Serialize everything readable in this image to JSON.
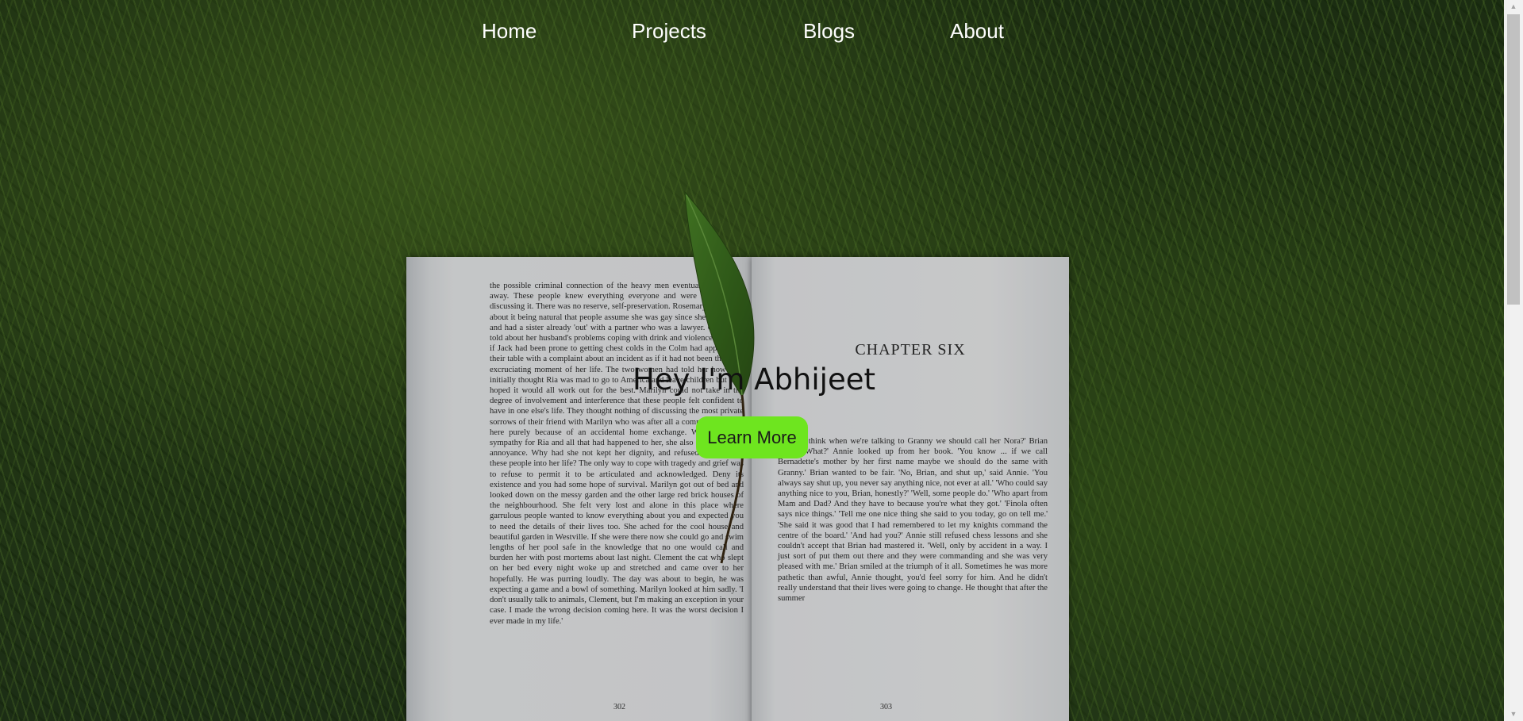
{
  "nav": {
    "items": [
      {
        "label": "Home"
      },
      {
        "label": "Projects"
      },
      {
        "label": "Blogs"
      },
      {
        "label": "About"
      }
    ]
  },
  "hero": {
    "title": "Hey I'm Abhijeet",
    "cta_label": "Learn More",
    "cta_color": "#6ee51f"
  },
  "book": {
    "chapter_heading": "CHAPTER SIX",
    "left_page_number": "302",
    "right_page_number": "303",
    "left_page_text": "the possible criminal connection of the heavy men eventually taken her away. These people knew everything everyone and were not slow in discussing it. There was no reserve, self-preservation. Rosemary had talked about it being natural that people assume she was gay since she was single and had a sister already 'out' with a partner who was a lawyer. Gertie had told about her husband's problems coping with drink and violence spoke as if Jack had been prone to getting chest colds in the Colm had approached their table with a complaint about an incident as if it had not been the most excruciating moment of her life. The two women had told her how they initially thought Ria was mad to go to America and leave children but they hoped it would all work out for the best. Marilyn could not take in the degree of involvement and interference that these people felt confident to have in one else's life. They thought nothing of discussing the most private sorrows of their friend with Marilyn who was after all a complete stranger, here purely because of an accidental home exchange. While she felt sympathy for Ria and all that had happened to her, she also felt a sense of annoyance. Why had she not kept her dignity, and refused to allow all these people into her life? The only way to cope with tragedy and grief was to refuse to permit it to be articulated and acknowledged. Deny its existence and you had some hope of survival. Marilyn got out of bed and looked down on the messy garden and the other large red brick houses of the neighbourhood. She felt very lost and alone in this place where garrulous people wanted to know everything about you and expected you to need the details of their lives too. She ached for the cool house and beautiful garden in Westville. If she were there now she could go and swim lengths of her pool safe in the knowledge that no one would call and burden her with post mortems about last night. Clement the cat who slept on her bed every night woke up and stretched and came over to her hopefully. He was purring loudly. The day was about to begin, he was expecting a game and a bowl of something. Marilyn looked at him sadly. 'I don't usually talk to animals, Clement, but I'm making an exception in your case. I made the wrong decision coming here. It was the worst decision I ever made in my life.'",
    "right_page_text": "'Do you think when we're talking to Granny we should call her Nora?' Brian asked. 'What?' Annie looked up from her book. 'You know ... if we call Bernadette's mother by her first name maybe we should do the same with Granny.' Brian wanted to be fair. 'No, Brian, and shut up,' said Annie. 'You always say shut up, you never say anything nice, not ever at all.' 'Who could say anything nice to you, Brian, honestly?' 'Well, some people do.' 'Who apart from Mam and Dad? And they have to because you're what they got.' 'Finola often says nice things.' 'Tell me one nice thing she said to you today, go on tell me.' 'She said it was good that I had remembered to let my knights command the centre of the board.' 'And had you?' Annie still refused chess lessons and she couldn't accept that Brian had mastered it. 'Well, only by accident in a way. I just sort of put them out there and they were commanding and she was very pleased with me.' Brian smiled at the triumph of it all. Sometimes he was more pathetic than awful, Annie thought, you'd feel sorry for him. And he didn't really understand that their lives were going to change. He thought that after the summer"
  }
}
